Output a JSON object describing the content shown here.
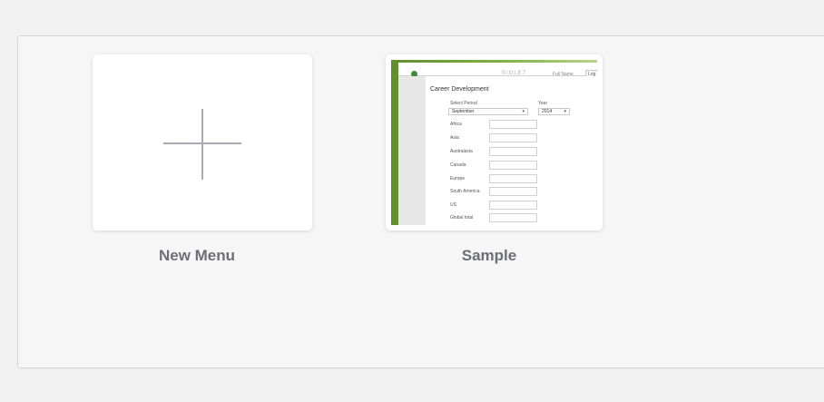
{
  "tiles": [
    {
      "label": "New Menu",
      "icon": "plus-icon"
    },
    {
      "label": "Sample"
    }
  ],
  "thumbnail": {
    "app_title": "BIOLE7",
    "user_text": "Full Name",
    "button_text": "Log",
    "heading": "Career Development",
    "period_label": "Select Period",
    "period_value": "September",
    "year_label": "Year",
    "year_value": "2014",
    "regions": [
      "Africa",
      "Asia",
      "Australasia",
      "Canada",
      "Europe",
      "South America",
      "US",
      "Global total"
    ]
  },
  "colors": {
    "accent_green": "#7fb246",
    "plus_color": "#a9aab6",
    "label_color": "#6e6f75"
  }
}
